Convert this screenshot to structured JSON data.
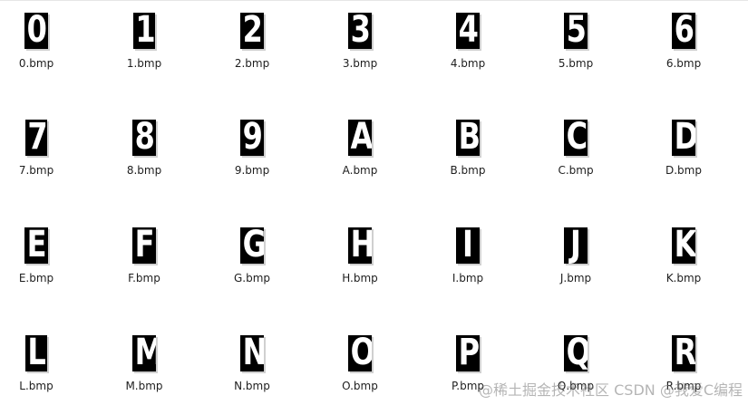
{
  "files": [
    {
      "glyph": "0",
      "name": "0.bmp"
    },
    {
      "glyph": "1",
      "name": "1.bmp"
    },
    {
      "glyph": "2",
      "name": "2.bmp"
    },
    {
      "glyph": "3",
      "name": "3.bmp"
    },
    {
      "glyph": "4",
      "name": "4.bmp"
    },
    {
      "glyph": "5",
      "name": "5.bmp"
    },
    {
      "glyph": "6",
      "name": "6.bmp"
    },
    {
      "glyph": "7",
      "name": "7.bmp"
    },
    {
      "glyph": "8",
      "name": "8.bmp"
    },
    {
      "glyph": "9",
      "name": "9.bmp"
    },
    {
      "glyph": "A",
      "name": "A.bmp"
    },
    {
      "glyph": "B",
      "name": "B.bmp"
    },
    {
      "glyph": "C",
      "name": "C.bmp"
    },
    {
      "glyph": "D",
      "name": "D.bmp"
    },
    {
      "glyph": "E",
      "name": "E.bmp"
    },
    {
      "glyph": "F",
      "name": "F.bmp"
    },
    {
      "glyph": "G",
      "name": "G.bmp"
    },
    {
      "glyph": "H",
      "name": "H.bmp"
    },
    {
      "glyph": "I",
      "name": "I.bmp"
    },
    {
      "glyph": "J",
      "name": "J.bmp"
    },
    {
      "glyph": "K",
      "name": "K.bmp"
    },
    {
      "glyph": "L",
      "name": "L.bmp"
    },
    {
      "glyph": "M",
      "name": "M.bmp"
    },
    {
      "glyph": "N",
      "name": "N.bmp"
    },
    {
      "glyph": "O",
      "name": "O.bmp"
    },
    {
      "glyph": "P",
      "name": "P.bmp"
    },
    {
      "glyph": "Q",
      "name": "Q.bmp"
    },
    {
      "glyph": "R",
      "name": "R.bmp"
    }
  ],
  "watermark": "@稀土掘金技术社区 CSDN @我爱C编程"
}
